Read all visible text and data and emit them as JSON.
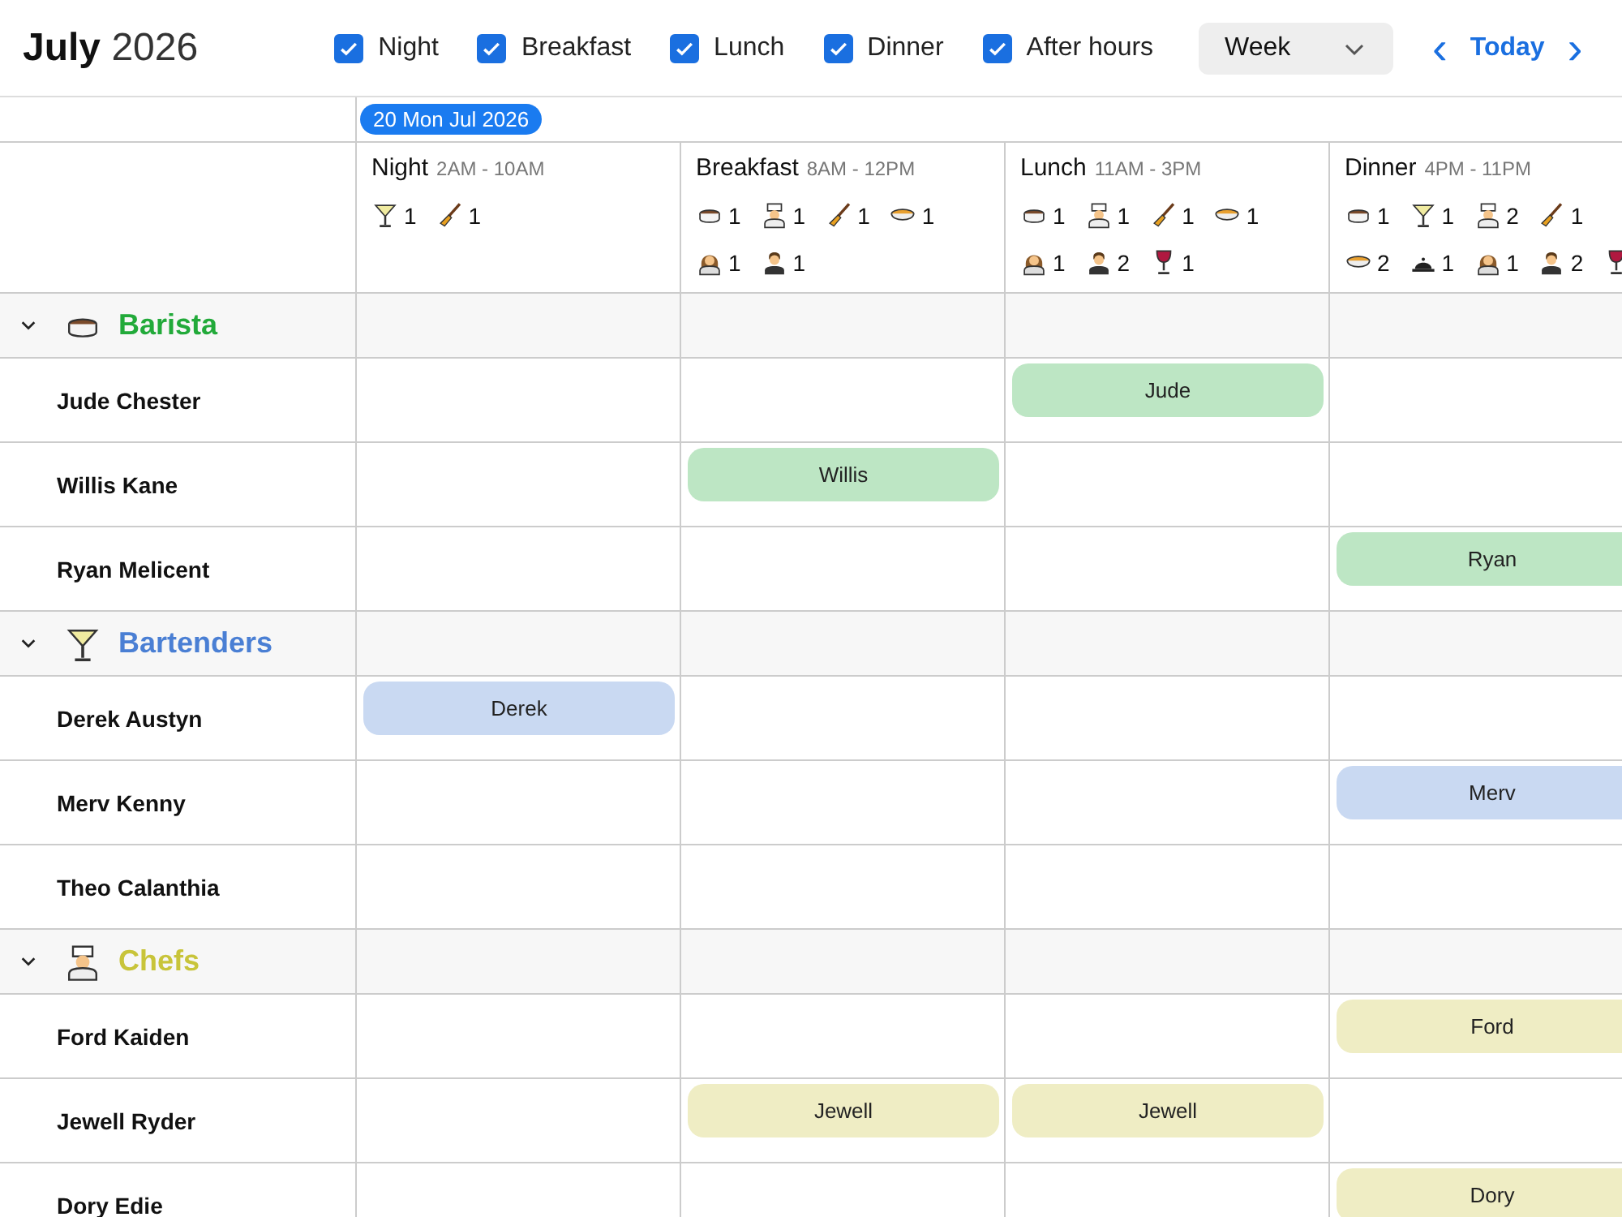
{
  "title": {
    "month": "July",
    "year": "2026"
  },
  "filters": [
    {
      "label": "Night",
      "checked": true
    },
    {
      "label": "Breakfast",
      "checked": true
    },
    {
      "label": "Lunch",
      "checked": true
    },
    {
      "label": "Dinner",
      "checked": true
    },
    {
      "label": "After hours",
      "checked": true
    }
  ],
  "view_select": {
    "value": "Week"
  },
  "nav": {
    "prev": "‹",
    "today": "Today",
    "next": "›"
  },
  "date_badge": "20 Mon Jul 2026",
  "shifts": [
    {
      "name": "Night",
      "time": "2AM - 10AM",
      "demand": [
        {
          "kind": "cocktail",
          "count": "1"
        },
        {
          "kind": "broom",
          "count": "1"
        }
      ]
    },
    {
      "name": "Breakfast",
      "time": "8AM - 12PM",
      "demand": [
        {
          "kind": "coffee",
          "count": "1"
        },
        {
          "kind": "chef",
          "count": "1"
        },
        {
          "kind": "broom",
          "count": "1"
        },
        {
          "kind": "soup",
          "count": "1"
        },
        {
          "kind": "waitress",
          "count": "1"
        },
        {
          "kind": "waiter",
          "count": "1"
        }
      ]
    },
    {
      "name": "Lunch",
      "time": "11AM - 3PM",
      "demand": [
        {
          "kind": "coffee",
          "count": "1"
        },
        {
          "kind": "chef",
          "count": "1"
        },
        {
          "kind": "broom",
          "count": "1"
        },
        {
          "kind": "soup",
          "count": "1"
        },
        {
          "kind": "waitress",
          "count": "1"
        },
        {
          "kind": "waiter",
          "count": "2"
        },
        {
          "kind": "wine",
          "count": "1"
        }
      ]
    },
    {
      "name": "Dinner",
      "time": "4PM - 11PM",
      "demand": [
        {
          "kind": "coffee",
          "count": "1"
        },
        {
          "kind": "cocktail",
          "count": "1"
        },
        {
          "kind": "chef",
          "count": "2"
        },
        {
          "kind": "broom",
          "count": "1"
        },
        {
          "kind": "soup",
          "count": "2"
        },
        {
          "kind": "bell",
          "count": "1"
        },
        {
          "kind": "waitress",
          "count": "1"
        },
        {
          "kind": "waiter",
          "count": "2"
        },
        {
          "kind": "wine"
        }
      ]
    }
  ],
  "groups": [
    {
      "name": "Barista",
      "kind": "coffee",
      "color": "#22aa3a",
      "expanded": true,
      "people": [
        {
          "name": "Jude Chester",
          "cells": [
            {
              "assigned": false
            },
            {
              "assigned": false
            },
            {
              "assigned": true,
              "label": "Jude"
            },
            {
              "assigned": false
            }
          ]
        },
        {
          "name": "Willis Kane",
          "cells": [
            {
              "assigned": false
            },
            {
              "assigned": true,
              "label": "Willis"
            },
            {
              "assigned": false
            },
            {
              "assigned": false
            }
          ]
        },
        {
          "name": "Ryan Melicent",
          "cells": [
            {
              "assigned": false
            },
            {
              "assigned": false
            },
            {
              "assigned": false
            },
            {
              "assigned": true,
              "label": "Ryan"
            }
          ]
        }
      ]
    },
    {
      "name": "Bartenders",
      "kind": "cocktail",
      "color": "#4a7fd4",
      "expanded": true,
      "people": [
        {
          "name": "Derek Austyn",
          "cells": [
            {
              "assigned": true,
              "label": "Derek"
            },
            {
              "assigned": false
            },
            {
              "assigned": false
            },
            {
              "assigned": false
            }
          ]
        },
        {
          "name": "Merv Kenny",
          "cells": [
            {
              "assigned": false
            },
            {
              "assigned": false
            },
            {
              "assigned": false
            },
            {
              "assigned": true,
              "label": "Merv"
            }
          ]
        },
        {
          "name": "Theo Calanthia",
          "cells": [
            {
              "assigned": false
            },
            {
              "assigned": false
            },
            {
              "assigned": false
            },
            {
              "assigned": false
            }
          ]
        }
      ]
    },
    {
      "name": "Chefs",
      "kind": "chef",
      "color": "#c8c43a",
      "expanded": true,
      "people": [
        {
          "name": "Ford Kaiden",
          "cells": [
            {
              "assigned": false
            },
            {
              "assigned": false
            },
            {
              "assigned": false
            },
            {
              "assigned": true,
              "label": "Ford"
            }
          ]
        },
        {
          "name": "Jewell Ryder",
          "cells": [
            {
              "assigned": false
            },
            {
              "assigned": true,
              "label": "Jewell"
            },
            {
              "assigned": true,
              "label": "Jewell"
            },
            {
              "assigned": false
            }
          ]
        },
        {
          "name": "Dory Edie",
          "cells": [
            {
              "assigned": false
            },
            {
              "assigned": false
            },
            {
              "assigned": false
            },
            {
              "assigned": true,
              "label": "Dory"
            }
          ]
        }
      ]
    }
  ]
}
